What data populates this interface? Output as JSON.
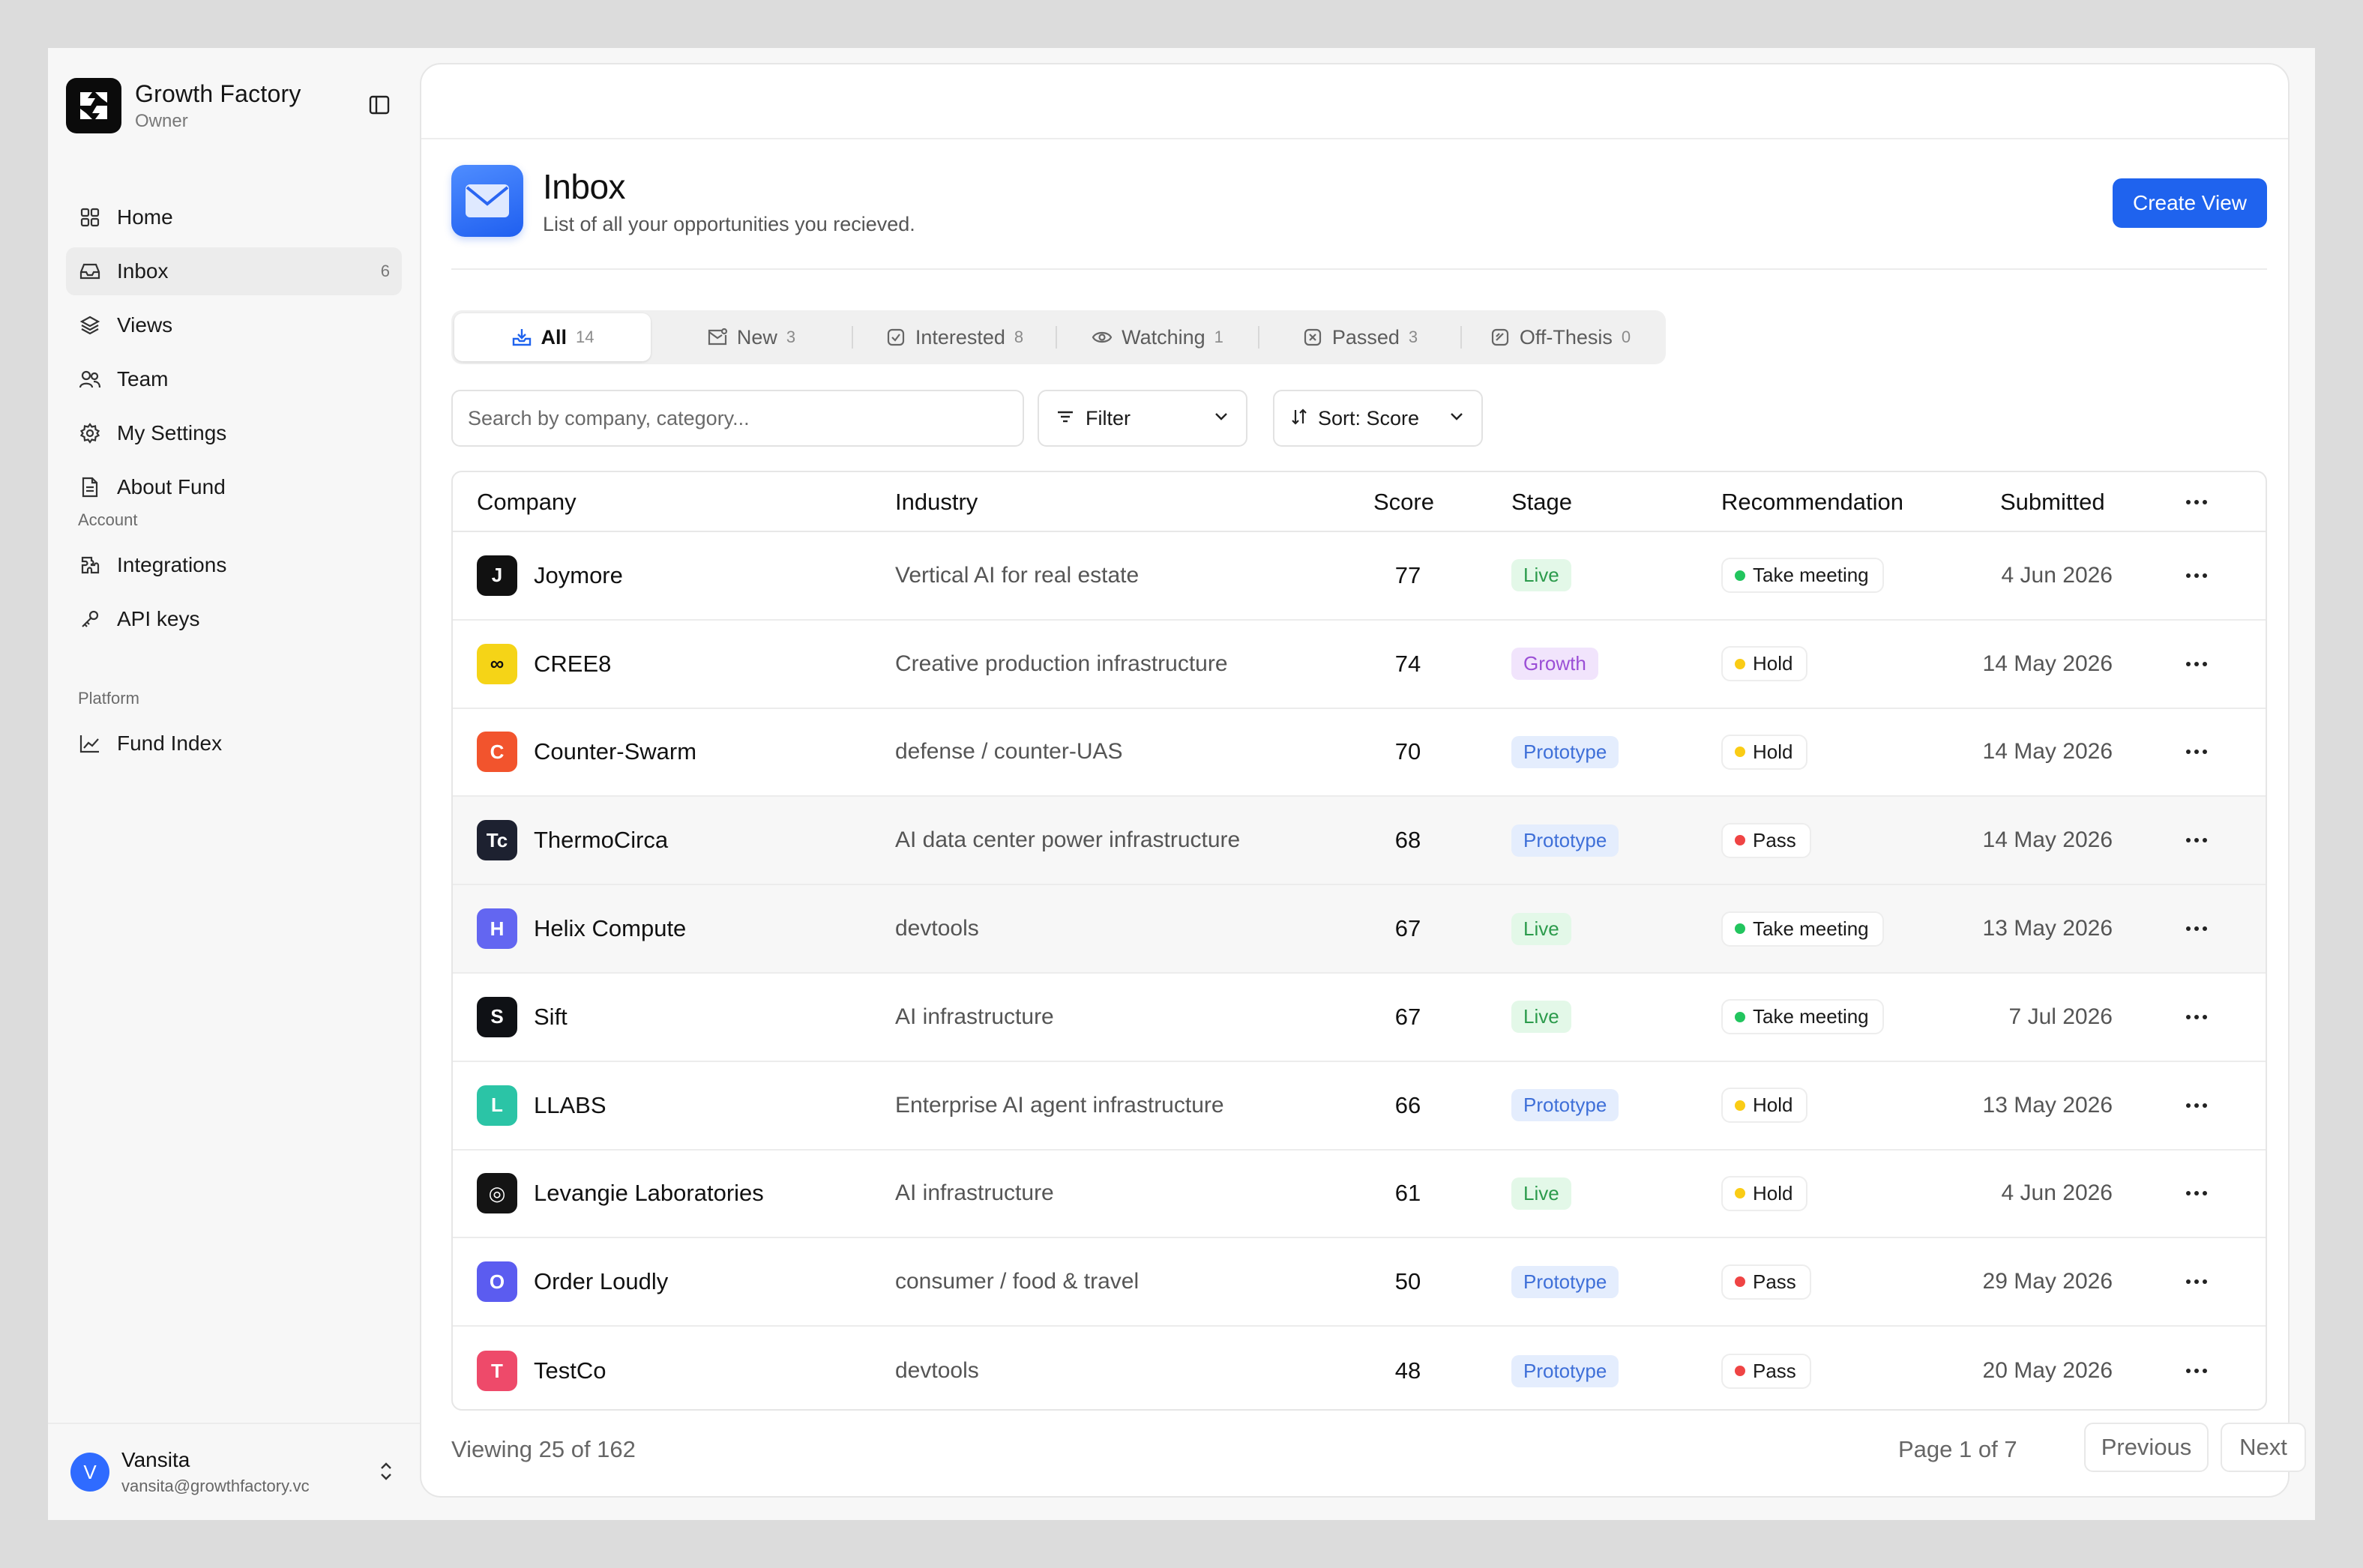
{
  "brand": {
    "name": "Growth Factory",
    "role": "Owner"
  },
  "nav": [
    {
      "label": "Home",
      "icon": "grid-icon"
    },
    {
      "label": "Inbox",
      "icon": "inbox-icon",
      "count": "6",
      "active": true
    },
    {
      "label": "Views",
      "icon": "layers-icon"
    },
    {
      "label": "Team",
      "icon": "users-icon"
    },
    {
      "label": "My Settings",
      "icon": "gear-icon"
    },
    {
      "label": "About Fund",
      "icon": "document-icon"
    }
  ],
  "account_section": {
    "label": "Account",
    "items": [
      {
        "label": "Integrations",
        "icon": "puzzle-icon"
      },
      {
        "label": "API keys",
        "icon": "key-icon"
      }
    ]
  },
  "platform_section": {
    "label": "Platform",
    "items": [
      {
        "label": "Fund Index",
        "icon": "chart-icon"
      }
    ]
  },
  "user": {
    "initial": "V",
    "name": "Vansita",
    "email": "vansita@growthfactory.vc"
  },
  "header": {
    "title": "Inbox",
    "subtitle": "List of all your opportunities you recieved.",
    "create_label": "Create View"
  },
  "tabs": [
    {
      "label": "All",
      "count": "14",
      "active": true
    },
    {
      "label": "New",
      "count": "3"
    },
    {
      "label": "Interested",
      "count": "8"
    },
    {
      "label": "Watching",
      "count": "1"
    },
    {
      "label": "Passed",
      "count": "3"
    },
    {
      "label": "Off-Thesis",
      "count": "0"
    }
  ],
  "search": {
    "placeholder": "Search by company, category..."
  },
  "filter_label": "Filter",
  "sort_label": "Sort: Score",
  "table": {
    "columns": [
      "Company",
      "Industry",
      "Score",
      "Stage",
      "Recommendation",
      "Submitted"
    ],
    "rows": [
      {
        "company": "Joymore",
        "logo": "J",
        "logo_bg": "#111111",
        "industry": "Vertical AI for real estate",
        "score": "77",
        "stage": "Live",
        "rec": "Take meeting",
        "submitted": "4 Jun 2026"
      },
      {
        "company": "CREE8",
        "logo": "∞",
        "logo_bg": "#f5d417",
        "industry": "Creative production infrastructure",
        "score": "74",
        "stage": "Growth",
        "rec": "Hold",
        "submitted": "14 May 2026"
      },
      {
        "company": "Counter-Swarm",
        "logo": "C",
        "logo_bg": "#f2542d",
        "industry": "defense / counter-UAS",
        "score": "70",
        "stage": "Prototype",
        "rec": "Hold",
        "submitted": "14 May 2026"
      },
      {
        "company": "ThermoCirca",
        "logo": "Tc",
        "logo_bg": "#1d2130",
        "industry": "AI data center power infrastructure",
        "score": "68",
        "stage": "Prototype",
        "rec": "Pass",
        "submitted": "14 May 2026"
      },
      {
        "company": "Helix Compute",
        "logo": "H",
        "logo_bg": "#6366f1",
        "industry": "devtools",
        "score": "67",
        "stage": "Live",
        "rec": "Take meeting",
        "submitted": "13 May 2026"
      },
      {
        "company": "Sift",
        "logo": "S",
        "logo_bg": "#0f1115",
        "industry": "AI infrastructure",
        "score": "67",
        "stage": "Live",
        "rec": "Take meeting",
        "submitted": "7 Jul 2026"
      },
      {
        "company": "LLABS",
        "logo": "L",
        "logo_bg": "#2bc4a6",
        "industry": "Enterprise AI agent infrastructure",
        "score": "66",
        "stage": "Prototype",
        "rec": "Hold",
        "submitted": "13 May 2026"
      },
      {
        "company": "Levangie Laboratories",
        "logo": "◎",
        "logo_bg": "#141414",
        "industry": "AI infrastructure",
        "score": "61",
        "stage": "Live",
        "rec": "Hold",
        "submitted": "4 Jun 2026"
      },
      {
        "company": "Order Loudly",
        "logo": "O",
        "logo_bg": "#5b5cf0",
        "industry": "consumer / food & travel",
        "score": "50",
        "stage": "Prototype",
        "rec": "Pass",
        "submitted": "29 May 2026"
      },
      {
        "company": "TestCo",
        "logo": "T",
        "logo_bg": "#ee4a6a",
        "industry": "devtools",
        "score": "48",
        "stage": "Prototype",
        "rec": "Pass",
        "submitted": "20 May 2026"
      }
    ]
  },
  "footer": {
    "viewing": "Viewing 25 of 162",
    "page": "Page 1 of 7",
    "previous": "Previous",
    "next": "Next"
  },
  "colors": {
    "accent": "#1f63ee",
    "rec_take_meeting": "#22c55e",
    "rec_hold": "#facc15",
    "rec_pass": "#ef4444"
  }
}
